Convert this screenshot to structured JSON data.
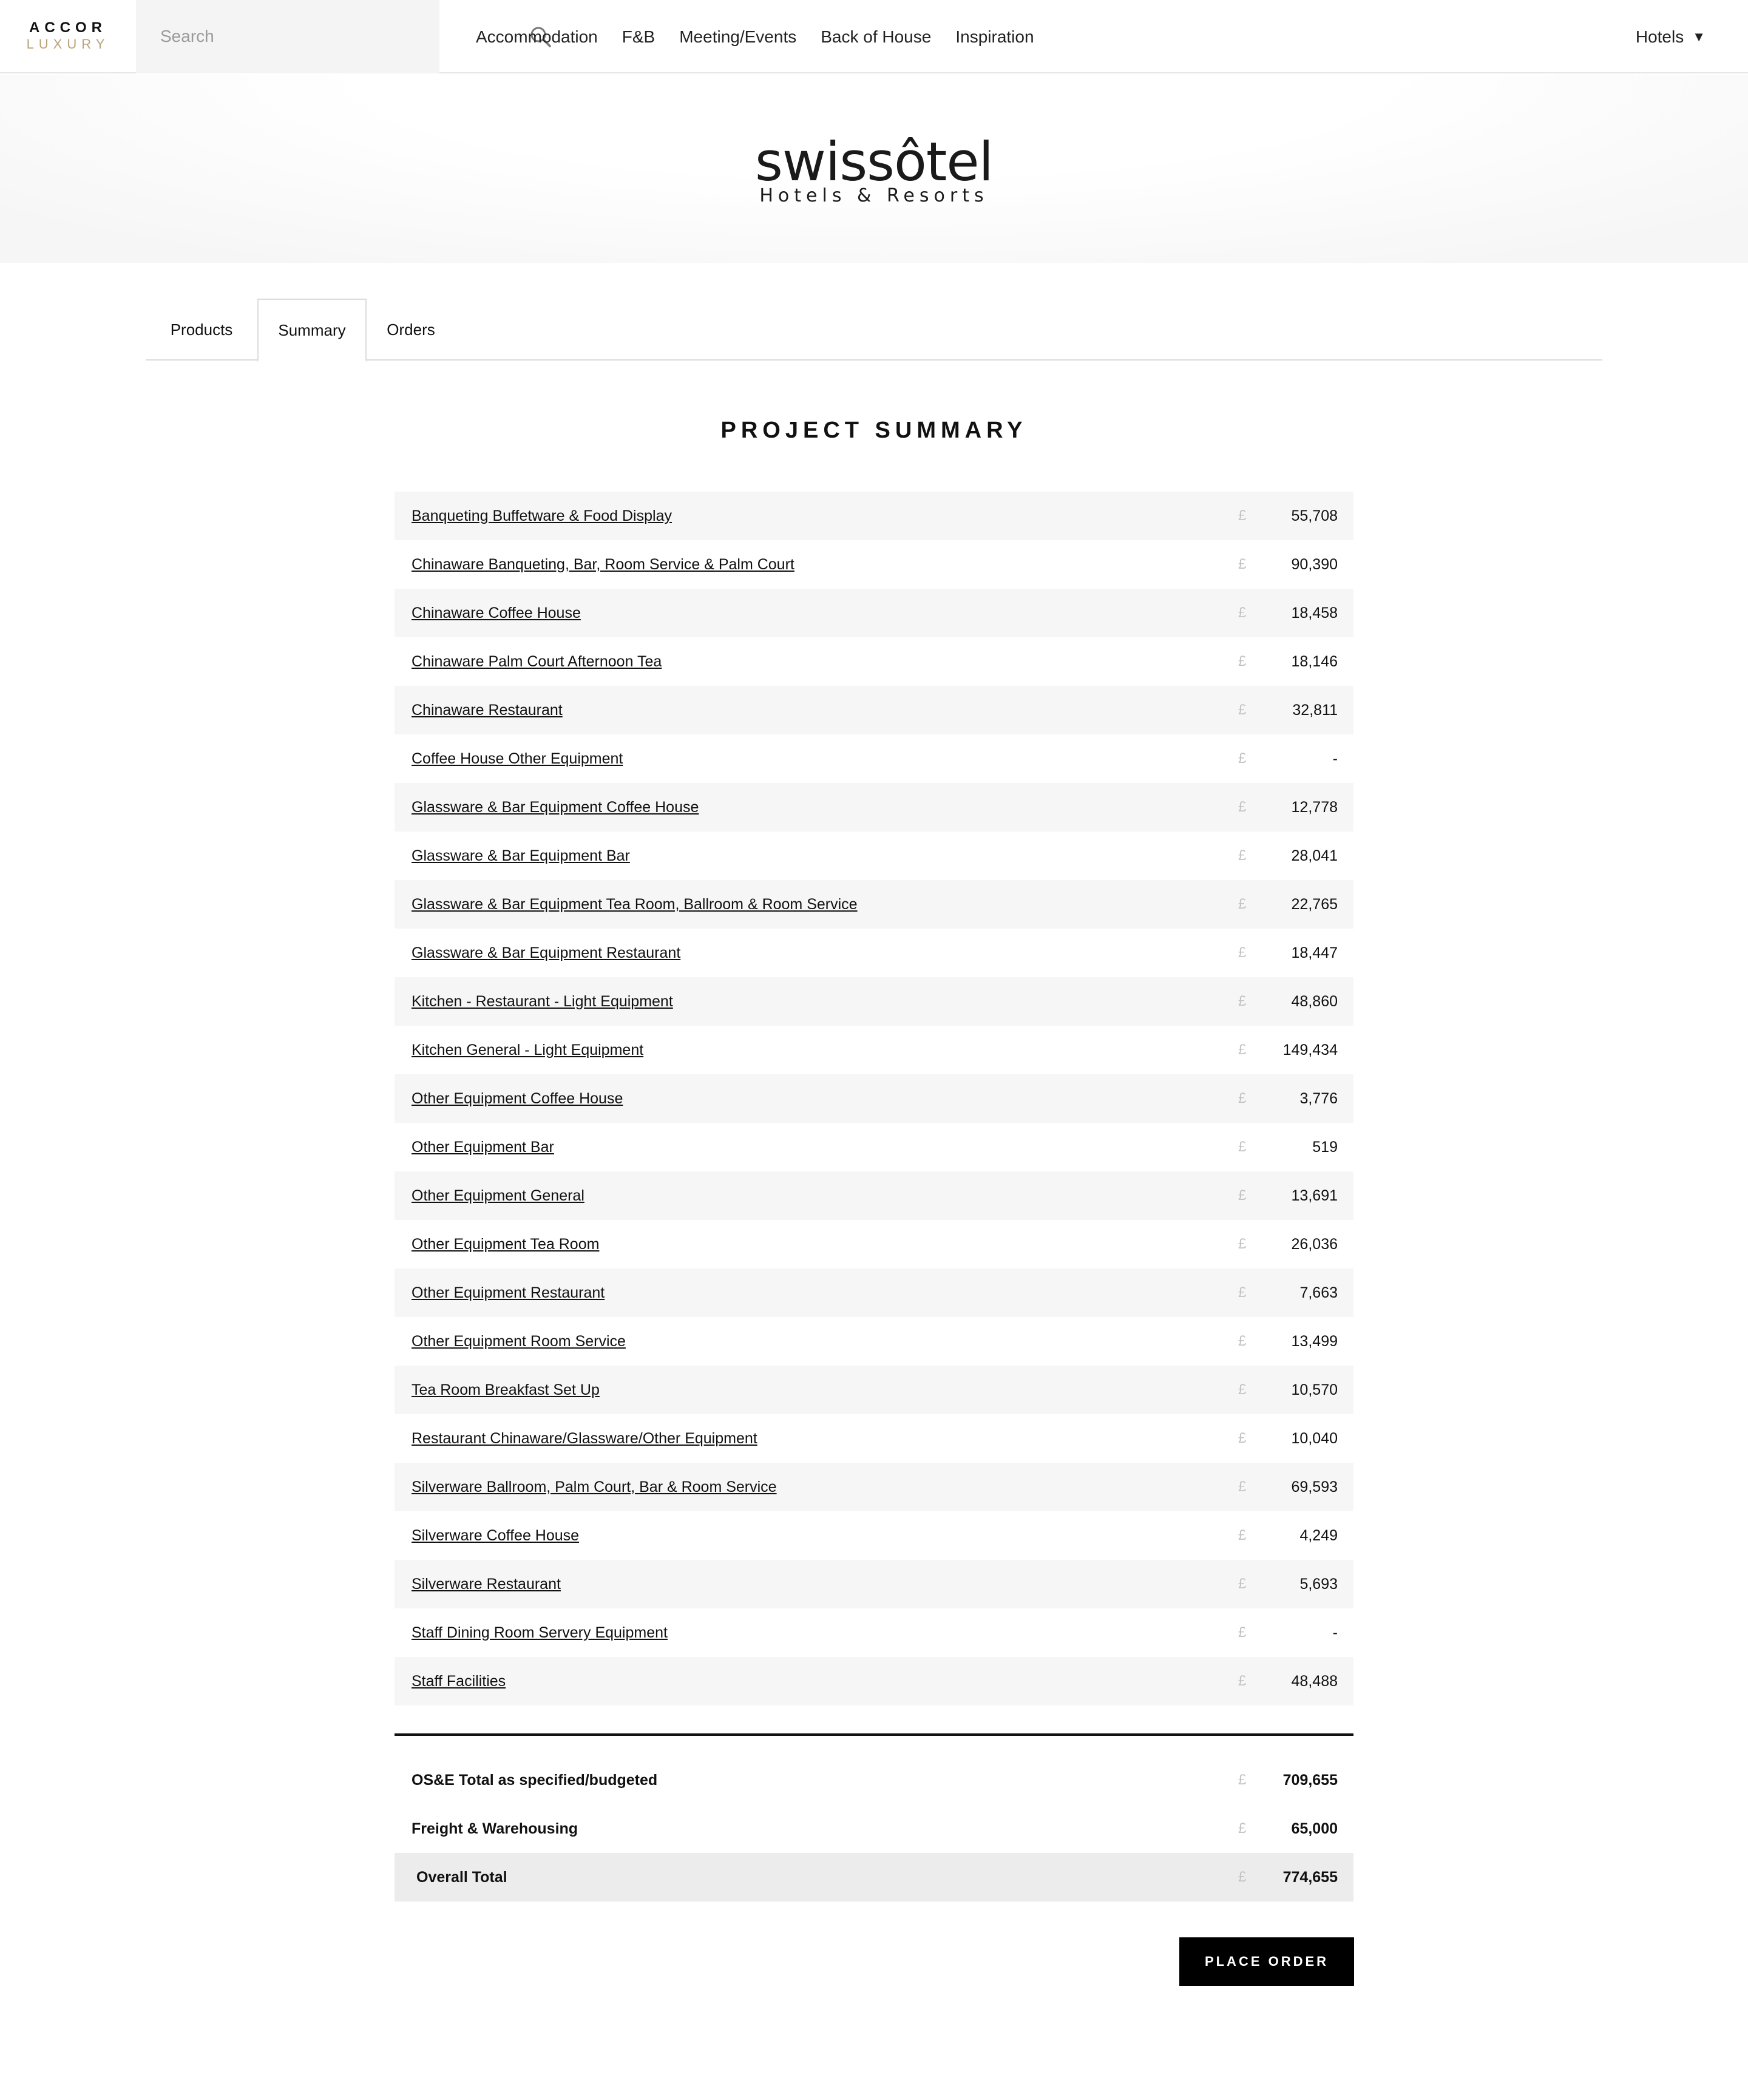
{
  "brand": {
    "top": "ACCOR",
    "bottom": "LUXURY"
  },
  "search": {
    "placeholder": "Search",
    "icon": "search-icon"
  },
  "nav": {
    "items": [
      "Accommodation",
      "F&B",
      "Meeting/Events",
      "Back of House",
      "Inspiration"
    ],
    "hotels_label": "Hotels",
    "hotels_caret": "▼"
  },
  "logo": {
    "main": "swissôtel",
    "sub": "Hotels & Resorts"
  },
  "tabs": [
    {
      "label": "Products",
      "active": false
    },
    {
      "label": "Summary",
      "active": true
    },
    {
      "label": "Orders",
      "active": false
    }
  ],
  "summary": {
    "title": "PROJECT SUMMARY",
    "currency": "£",
    "rows": [
      {
        "label": "Banqueting Buffetware & Food Display",
        "amount": "55,708"
      },
      {
        "label": "Chinaware Banqueting, Bar, Room Service & Palm Court",
        "amount": "90,390"
      },
      {
        "label": "Chinaware Coffee House",
        "amount": "18,458"
      },
      {
        "label": "Chinaware Palm Court Afternoon Tea",
        "amount": "18,146"
      },
      {
        "label": "Chinaware Restaurant",
        "amount": "32,811"
      },
      {
        "label": "Coffee House Other Equipment",
        "amount": "-"
      },
      {
        "label": "Glassware & Bar Equipment Coffee House",
        "amount": "12,778"
      },
      {
        "label": "Glassware & Bar Equipment Bar",
        "amount": "28,041"
      },
      {
        "label": "Glassware & Bar Equipment Tea Room, Ballroom & Room Service",
        "amount": "22,765"
      },
      {
        "label": "Glassware & Bar Equipment Restaurant",
        "amount": "18,447"
      },
      {
        "label": "Kitchen - Restaurant - Light Equipment",
        "amount": "48,860"
      },
      {
        "label": "Kitchen General - Light Equipment",
        "amount": "149,434"
      },
      {
        "label": "Other Equipment Coffee House",
        "amount": "3,776"
      },
      {
        "label": "Other Equipment Bar",
        "amount": "519"
      },
      {
        "label": "Other Equipment General",
        "amount": "13,691"
      },
      {
        "label": "Other Equipment Tea Room",
        "amount": "26,036"
      },
      {
        "label": "Other Equipment Restaurant",
        "amount": "7,663"
      },
      {
        "label": "Other Equipment Room Service",
        "amount": "13,499"
      },
      {
        "label": "Tea Room Breakfast Set Up",
        "amount": "10,570"
      },
      {
        "label": "Restaurant Chinaware/Glassware/Other Equipment",
        "amount": "10,040"
      },
      {
        "label": "Silverware Ballroom, Palm Court, Bar & Room Service",
        "amount": "69,593"
      },
      {
        "label": "Silverware Coffee House",
        "amount": "4,249"
      },
      {
        "label": "Silverware Restaurant",
        "amount": "5,693"
      },
      {
        "label": "Staff Dining Room Servery Equipment",
        "amount": "-"
      },
      {
        "label": "Staff Facilities",
        "amount": "48,488"
      }
    ],
    "totals": [
      {
        "label": "OS&E Total as specified/budgeted",
        "amount": "709,655"
      },
      {
        "label": "Freight & Warehousing",
        "amount": "65,000"
      },
      {
        "label": "Overall Total",
        "amount": "774,655"
      }
    ],
    "place_order": "PLACE ORDER"
  }
}
